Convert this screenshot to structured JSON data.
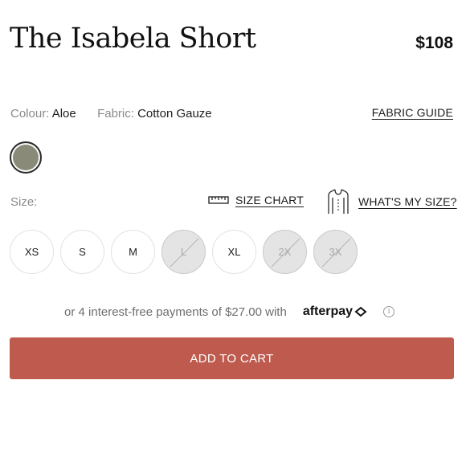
{
  "product": {
    "title": "The Isabela Short",
    "price": "$108"
  },
  "attributes": {
    "colour_label": "Colour:",
    "colour_value": "Aloe",
    "fabric_label": "Fabric:",
    "fabric_value": "Cotton Gauze",
    "fabric_guide_link": "FABRIC GUIDE",
    "swatch_color": "#8a8a78"
  },
  "size": {
    "label": "Size:",
    "size_chart_link": "SIZE CHART",
    "whats_my_size_link": "WHAT'S MY SIZE?",
    "options": [
      {
        "label": "XS",
        "available": true
      },
      {
        "label": "S",
        "available": true
      },
      {
        "label": "M",
        "available": true
      },
      {
        "label": "L",
        "available": false
      },
      {
        "label": "XL",
        "available": true
      },
      {
        "label": "2X",
        "available": false
      },
      {
        "label": "3X",
        "available": false
      }
    ]
  },
  "payment": {
    "installments_text": "or 4 interest-free payments of $27.00 with",
    "provider": "afterpay",
    "info_symbol": "i"
  },
  "cart": {
    "add_label": "ADD TO CART",
    "button_color": "#bf5b4e"
  }
}
